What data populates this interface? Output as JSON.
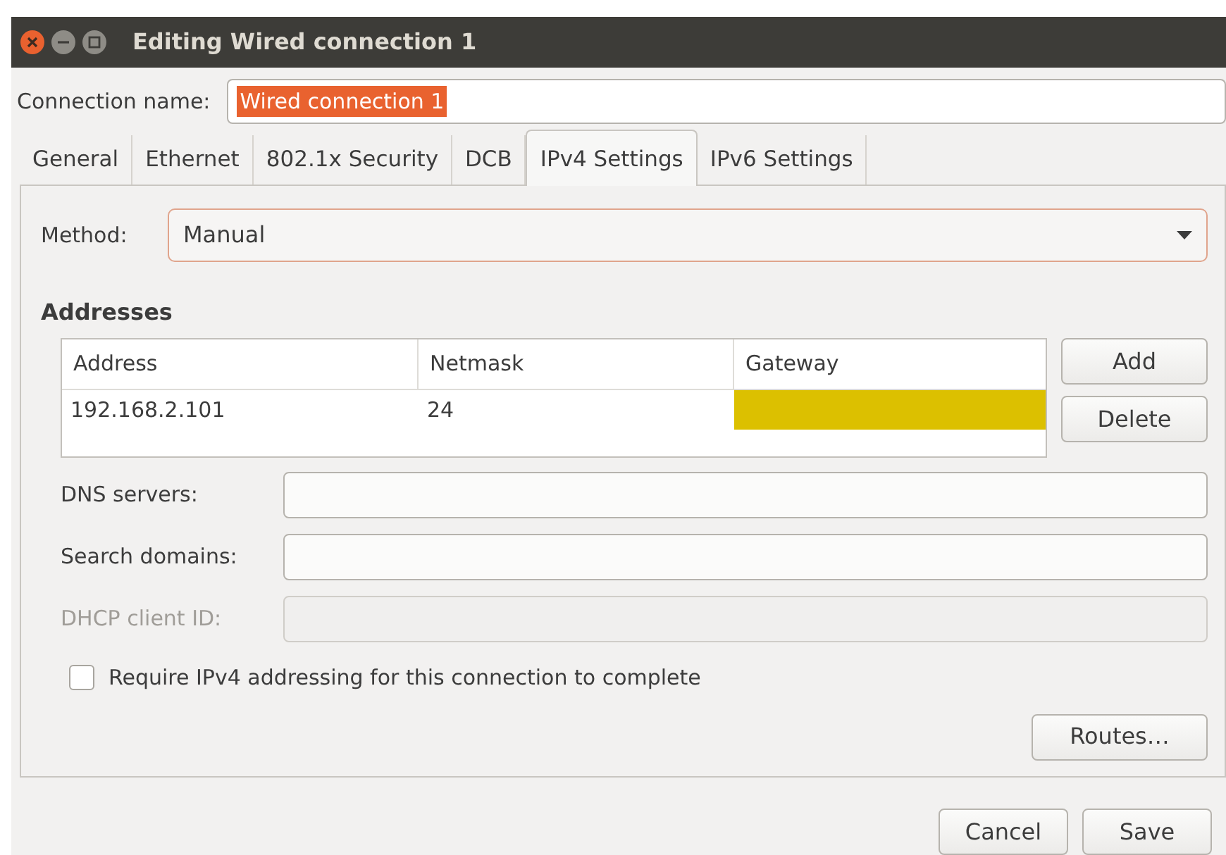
{
  "window": {
    "title": "Editing Wired connection 1"
  },
  "connection_name": {
    "label": "Connection name:",
    "value": "Wired connection 1",
    "text_selected": true
  },
  "tabs": [
    {
      "label": "General",
      "selected": false
    },
    {
      "label": "Ethernet",
      "selected": false
    },
    {
      "label": "802.1x Security",
      "selected": false
    },
    {
      "label": "DCB",
      "selected": false
    },
    {
      "label": "IPv4 Settings",
      "selected": true
    },
    {
      "label": "IPv6 Settings",
      "selected": false
    }
  ],
  "method": {
    "label": "Method:",
    "value": "Manual"
  },
  "addresses": {
    "title": "Addresses",
    "columns": [
      "Address",
      "Netmask",
      "Gateway"
    ],
    "rows": [
      {
        "address": "192.168.2.101",
        "netmask": "24",
        "gateway_editing": true
      }
    ],
    "buttons": [
      "Add",
      "Delete"
    ]
  },
  "fields": [
    {
      "label": "DNS servers:",
      "disabled": false
    },
    {
      "label": "Search domains:",
      "disabled": false
    },
    {
      "label": "DHCP client ID:",
      "disabled": true
    }
  ],
  "require_checkbox": {
    "label": "Require IPv4 addressing for this connection to complete",
    "checked": false
  },
  "routes_button": "Routes…",
  "dialog_buttons": [
    "Cancel",
    "Save"
  ]
}
